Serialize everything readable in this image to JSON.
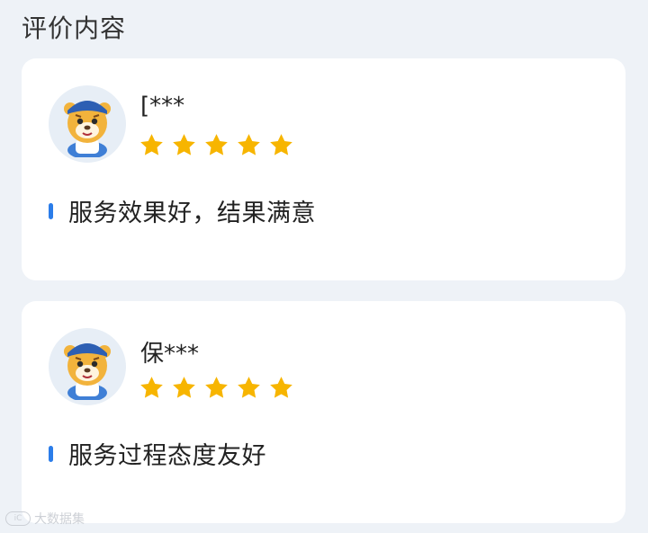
{
  "section_title": "评价内容",
  "reviews": [
    {
      "reviewer": "[***",
      "rating": 5,
      "comment": "服务效果好，结果满意",
      "avatar_icon": "tiger-mascot-icon"
    },
    {
      "reviewer": "保***",
      "rating": 5,
      "comment": "服务过程态度友好",
      "avatar_icon": "tiger-mascot-icon"
    }
  ],
  "watermark": {
    "logo": "iC",
    "text": "大数据集"
  },
  "colors": {
    "star": "#f7b500",
    "accent": "#2b7de9",
    "page_bg": "#eef2f7",
    "card_bg": "#ffffff"
  }
}
